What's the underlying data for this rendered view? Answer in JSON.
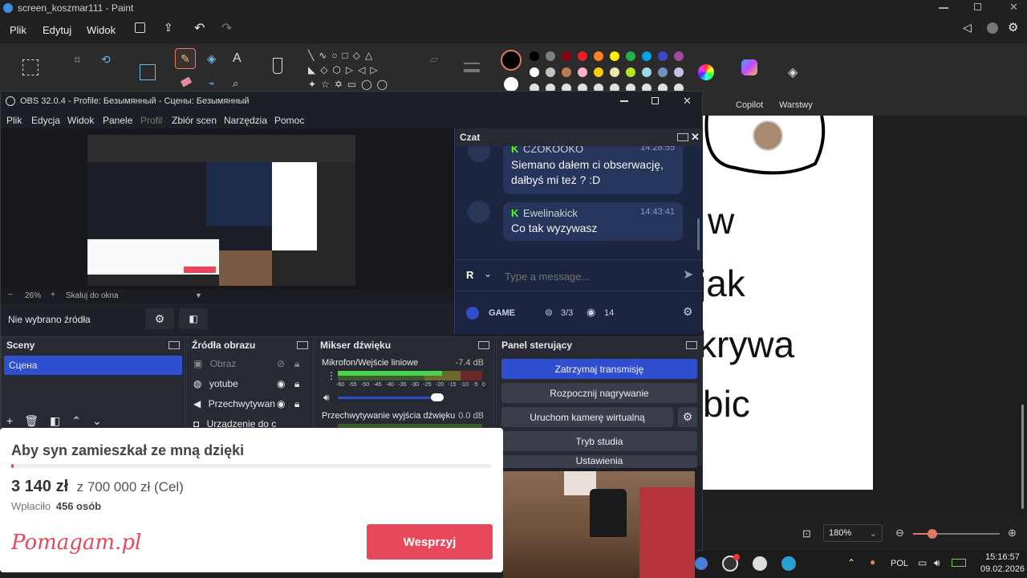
{
  "paint": {
    "title": "screen_koszmar111 - Paint",
    "menu": [
      "Plik",
      "Edytuj",
      "Widok"
    ],
    "ribbon_labels": {
      "copilot": "Copilot",
      "layers": "Warstwy"
    },
    "palette_row1": [
      "#000000",
      "#7f7f7f",
      "#880015",
      "#ed1c24",
      "#ff7f27",
      "#fff200",
      "#22b14c",
      "#00a2e8",
      "#3f48cc",
      "#a349a4"
    ],
    "palette_row2": [
      "#ffffff",
      "#c3c3c3",
      "#b97a57",
      "#ffaec9",
      "#ffc90e",
      "#efe4b0",
      "#b5e61d",
      "#99d9ea",
      "#7092be",
      "#c8bfe7"
    ],
    "palette_row3": [
      "#e0e0e0",
      "#e0e0e0",
      "#e0e0e0",
      "#e0e0e0",
      "#e0e0e0",
      "#e0e0e0",
      "#e0e0e0",
      "#e0e0e0",
      "#e0e0e0",
      "#e0e0e0"
    ],
    "canvas_text": [
      "w",
      "jak",
      "krywa",
      "bic"
    ],
    "zoom": "180%"
  },
  "taskbar": {
    "lang": "POL",
    "time": "15:16:57",
    "date": "09.02.2026"
  },
  "obs": {
    "title": "OBS 32.0.4 - Profile: Безымянный - Сцены: Безымянный",
    "menu": [
      "Plik",
      "Edycja",
      "Widok",
      "Panele",
      "Profil",
      "Zbiór scen",
      "Narzędzia",
      "Pomoc"
    ],
    "zoom": "26%",
    "scale_mode": "Skaluj do okna",
    "no_source": "Nie wybrano źródła",
    "scenes": {
      "title": "Sceny",
      "items": [
        "Сцена"
      ]
    },
    "sources": {
      "title": "Źródła obrazu",
      "items": [
        "Obraz",
        "yotube",
        "Przechwytywan",
        "Urządzenie do c"
      ]
    },
    "mixer": {
      "title": "Mikser dźwięku",
      "channels": [
        {
          "name": "Mikrofon/Wejście liniowe",
          "db": "-7.4 dB",
          "level": 0.72
        },
        {
          "name": "Przechwytywanie wyjścia dźwięku",
          "db": "0.0 dB",
          "level": 1.0
        }
      ],
      "scale": [
        "-60",
        "-55",
        "-50",
        "-45",
        "-40",
        "-35",
        "-30",
        "-25",
        "-20",
        "-15",
        "-10",
        "-5",
        "0"
      ]
    },
    "controls": {
      "title": "Panel sterujący",
      "buttons": [
        "Zatrzymaj transmisję",
        "Rozpocznij nagrywanie",
        "Uruchom kamerę wirtualną",
        "Tryb studia",
        "Ustawienia"
      ]
    }
  },
  "chat": {
    "title": "Czat",
    "messages": [
      {
        "user": "CZOKOOKO",
        "time": "14:28:55",
        "text": "Siemano dałem ci obserwację, dałbyś mi też ? :D"
      },
      {
        "user": "Ewelinakick",
        "time": "14:43:41",
        "text": "Co tak wyzywasz"
      }
    ],
    "placeholder": "Type a message...",
    "channel": "GAME",
    "slots": "3/3",
    "viewers": "14"
  },
  "donation": {
    "title": "Aby syn zamieszkał ze mną dzięki",
    "amount": "3 140 zł",
    "goal": "z 700 000 zł (Cel)",
    "donors_prefix": "Wpłaciło",
    "donors_count": "456 osób",
    "brand": "Pomagam.pl",
    "button": "Wesprzyj",
    "brand_color": "#e8495a",
    "progress": 0.0045
  }
}
